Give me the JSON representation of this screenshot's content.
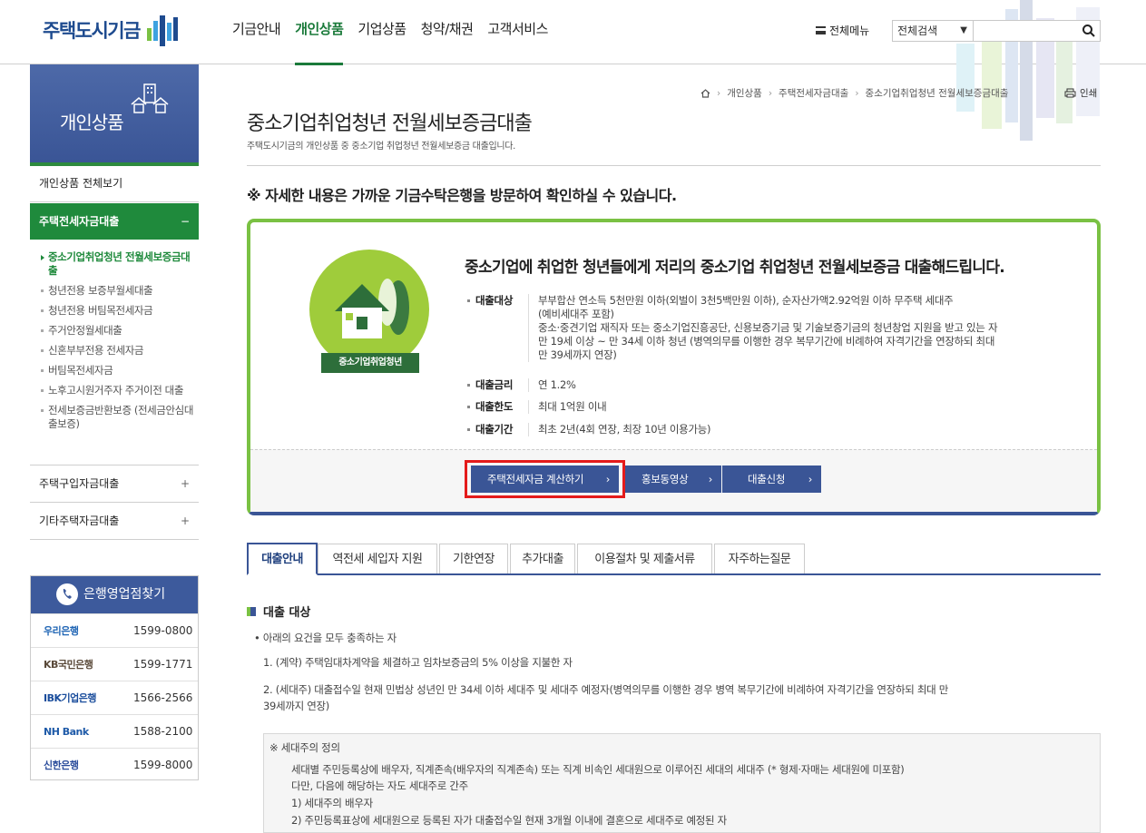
{
  "header": {
    "logo_text": "주택도시기금",
    "nav": [
      "기금안내",
      "개인상품",
      "기업상품",
      "청약/채권",
      "고객서비스"
    ],
    "all_menu": "전체메뉴",
    "search_select": "전체검색",
    "search_value": ""
  },
  "sidebar": {
    "title": "개인상품",
    "all_view": "개인상품 전체보기",
    "category": "주택전세자금대출",
    "category_sign": "−",
    "sub_items": [
      "중소기업취업청년 전월세보증금대출",
      "청년전용 보증부월세대출",
      "청년전용 버팀목전세자금",
      "주거안정월세대출",
      "신혼부부전용 전세자금",
      "버팀목전세자금",
      "노후고시원거주자 주거이전 대출",
      "전세보증금반환보증 (전세금안심대출보증)"
    ],
    "other_cats": [
      "주택구입자금대출",
      "기타주택자금대출"
    ],
    "plus_sign": "+"
  },
  "bank_finder": {
    "title": "은행영업점찾기",
    "banks": [
      {
        "name": "우리은행",
        "tel": "1599-0800",
        "color": "#1e64b4"
      },
      {
        "name": "KB국민은행",
        "tel": "1599-1771",
        "color": "#5a4a3a"
      },
      {
        "name": "IBK기업은행",
        "tel": "1566-2566",
        "color": "#1a4d9c"
      },
      {
        "name": "NH Bank",
        "tel": "1588-2100",
        "color": "#1e5aa8"
      },
      {
        "name": "신한은행",
        "tel": "1599-8000",
        "color": "#2a4c9b"
      }
    ]
  },
  "breadcrumb": [
    "개인상품",
    "주택전세자금대출",
    "중소기업취업청년 전월세보증금대출"
  ],
  "print_label": "인쇄",
  "page": {
    "title": "중소기업취업청년 전월세보증금대출",
    "desc": "주택도시기금의 개인상품 중 중소기업 취업청년 전월세보증금 대출입니다.",
    "notice": "※ 자세한 내용은 가까운 기금수탁은행을 방문하여 확인하실 수 있습니다."
  },
  "product": {
    "badge": "중소기업취업청년",
    "headline": "중소기업에 취업한 청년들에게 저리의 중소기업 취업청년 전월세보증금 대출해드립니다.",
    "rows": [
      {
        "label": "대출대상",
        "lines": [
          "부부합산 연소득 5천만원 이하(외벌이 3천5백만원 이하), 순자산가액2.92억원 이하 무주택 세대주",
          "(예비세대주 포함)",
          "중소·중견기업 재직자 또는 중소기업진흥공단, 신용보증기금 및 기술보증기금의 청년창업 지원을 받고 있는 자",
          "만 19세 이상 ~ 만 34세 이하 청년 (병역의무를 이행한 경우 복무기간에 비례하여 자격기간을 연장하되 최대",
          "만 39세까지 연장)"
        ]
      },
      {
        "label": "대출금리",
        "lines": [
          "연 1.2%"
        ]
      },
      {
        "label": "대출한도",
        "lines": [
          "최대 1억원 이내"
        ]
      },
      {
        "label": "대출기간",
        "lines": [
          "최초 2년(4회 연장, 최장 10년 이용가능)"
        ]
      }
    ],
    "buttons": [
      "주택전세자금 계산하기",
      "홍보동영상",
      "대출신청"
    ]
  },
  "tabs": [
    "대출안내",
    "역전세 세입자 지원",
    "기한연장",
    "추가대출",
    "이용절차 및 제출서류",
    "자주하는질문"
  ],
  "section": {
    "title": "대출 대상",
    "bullet": "아래의 요건을 모두 충족하는 자",
    "item1": "1. (계약) 주택임대차계약을 체결하고 임차보증금의 5% 이상을 지불한 자",
    "item2a": "2. (세대주) 대출접수일 현재 민법상 성년인 만 34세 이하 세대주 및 세대주 예정자(병역의무를 이행한 경우 병역 복무기간에 비례하여 자격기간을 연장하되 최대 만",
    "item2b": "39세까지 연장)",
    "info_title": "※ 세대주의 정의",
    "info_lines": [
      "세대별 주민등록상에 배우자, 직계존속(배우자의 직계존속) 또는 직계 비속인 세대원으로 이루어진 세대의 세대주 (* 형제·자매는 세대원에 미포함)",
      "다만, 다음에 해당하는 자도 세대주로 간주",
      "1) 세대주의 배우자",
      "2) 주민등록표상에 세대원으로 등록된 자가 대출접수일 현재 3개월 이내에 결혼으로 세대주로 예정된 자"
    ]
  },
  "colors": {
    "green": "#1f8a3c",
    "navy": "#3a5596",
    "highlight": "#e41b1b"
  }
}
